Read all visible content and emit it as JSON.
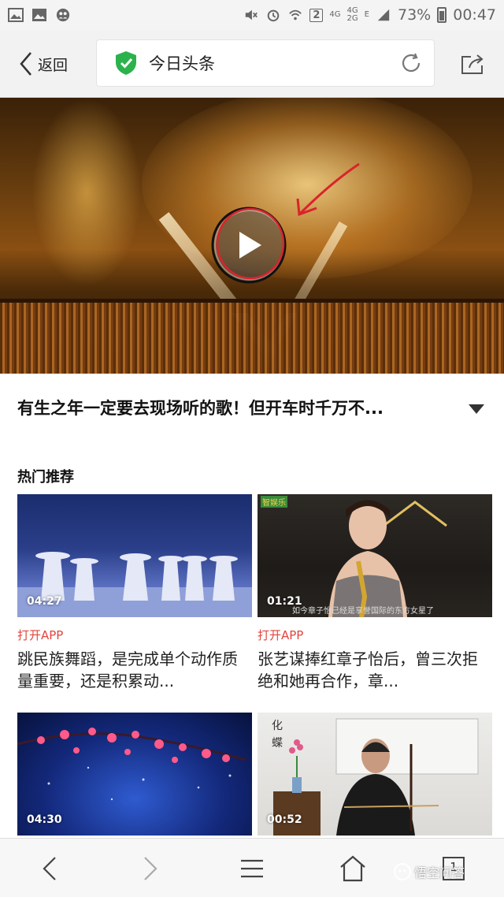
{
  "status_bar": {
    "network_small": "4G",
    "network_small_2": "4G",
    "network_small_3": "2G",
    "network_e": "E",
    "sim_badge": "2",
    "battery_percent": "73%",
    "time": "00:47",
    "icons": [
      "image-icon",
      "gallery-icon",
      "social-icon",
      "mute-icon",
      "alarm-icon",
      "wifi-icon",
      "signal-icon",
      "battery-icon"
    ]
  },
  "top_nav": {
    "back_label": "返回",
    "page_title": "今日头条",
    "shield_color": "#2bb24c"
  },
  "hero": {
    "play_icon": "play-icon",
    "annotation_color": "#d9242c"
  },
  "article": {
    "title": "有生之年一定要去现场听的歌！但开车时千万不..."
  },
  "recommend": {
    "section_title": "热门推荐",
    "cards": [
      {
        "duration": "04:27",
        "tag": "打开APP",
        "title": "跳民族舞蹈，是完成单个动作质量重要，还是积累动..."
      },
      {
        "duration": "01:21",
        "tag": "打开APP",
        "title": "张艺谋捧红章子怡后，曾三次拒绝和她再合作，章...",
        "thumb_logo": "智娱乐",
        "thumb_caption": "如今章子怡已经是享誉国际的东方女星了"
      },
      {
        "duration": "04:30"
      },
      {
        "duration": "00:52",
        "thumb_text_1": "化",
        "thumb_text_2": "蝶"
      }
    ]
  },
  "bottom_bar": {
    "tab_count": "1",
    "watermark": "悟空问答"
  }
}
